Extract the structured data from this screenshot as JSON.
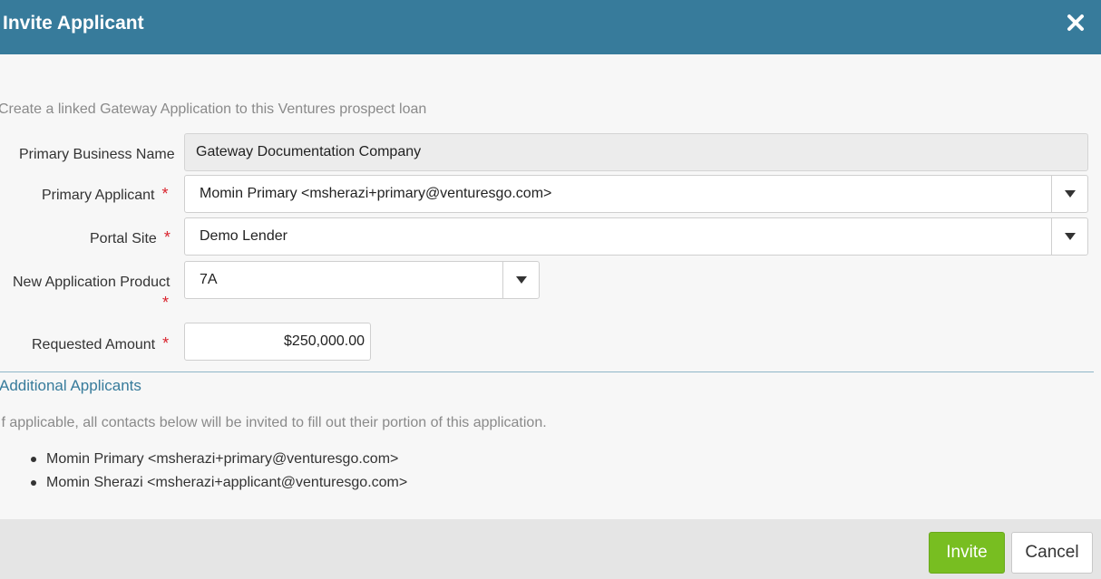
{
  "dialog": {
    "title": "Invite Applicant",
    "intro": "Create a linked Gateway Application to this Ventures prospect loan"
  },
  "form": {
    "business_name": {
      "label": "Primary Business Name",
      "value": "Gateway Documentation Company",
      "required": false
    },
    "primary_applicant": {
      "label": "Primary Applicant",
      "required_mark": "*",
      "value": "Momin Primary <msherazi+primary@venturesgo.com>"
    },
    "portal_site": {
      "label": "Portal Site",
      "required_mark": "*",
      "value": "Demo Lender"
    },
    "product": {
      "label": "New Application Product",
      "required_mark": "*",
      "value": "7A"
    },
    "requested_amount": {
      "label": "Requested Amount",
      "required_mark": "*",
      "value": "$250,000.00"
    }
  },
  "additional": {
    "title": "Additional Applicants",
    "note": "If applicable, all contacts below will be invited to fill out their portion of this application.",
    "applicants": [
      "Momin Primary <msherazi+primary@venturesgo.com>",
      "Momin Sherazi <msherazi+applicant@venturesgo.com>"
    ]
  },
  "footer": {
    "invite_label": "Invite",
    "cancel_label": "Cancel"
  },
  "colors": {
    "header": "#377b9b",
    "required": "#d9232d",
    "invite_button": "#78be21"
  },
  "icons": {
    "close": "close-icon",
    "dropdown": "caret-down-icon"
  }
}
